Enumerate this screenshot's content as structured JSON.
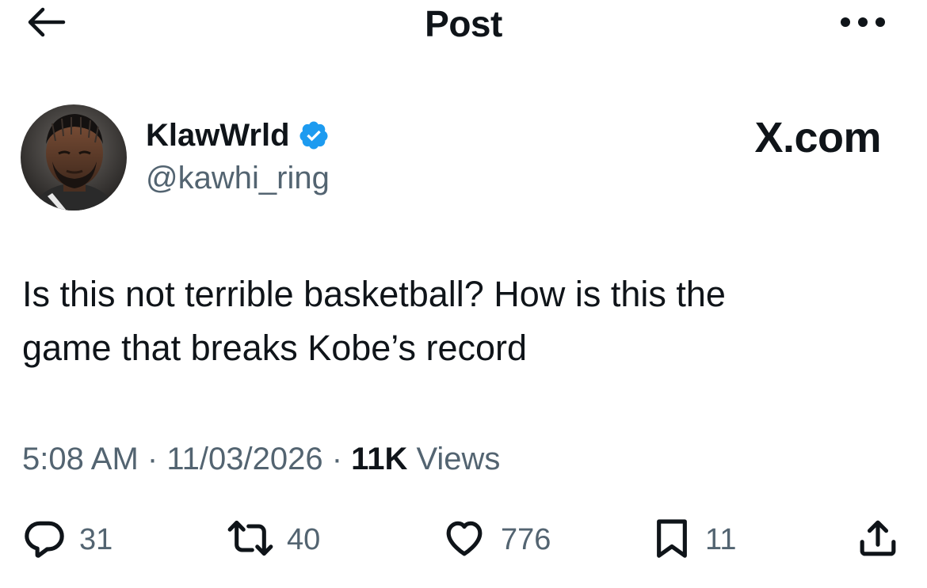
{
  "header": {
    "title": "Post"
  },
  "author": {
    "display_name": "KlawWrld",
    "handle": "@kawhi_ring",
    "verified": true
  },
  "source": "X.com",
  "post": {
    "text_line1": "Is this not terrible basketball? How is this the",
    "text_line2": "game that breaks Kobe’s record"
  },
  "meta": {
    "time": "5:08 AM",
    "separator": "·",
    "date": "11/03/2026",
    "views_count": "11K",
    "views_label": "Views"
  },
  "actions": {
    "replies": "31",
    "reposts": "40",
    "likes": "776",
    "bookmarks": "11"
  },
  "colors": {
    "text_primary": "#0f1419",
    "text_secondary": "#536471",
    "verified_blue": "#1d9bf0"
  },
  "icons": {
    "back": "arrow-left-icon",
    "more": "more-horizontal-icon",
    "verified": "verified-badge-icon",
    "reply": "reply-icon",
    "repost": "repost-icon",
    "like": "heart-icon",
    "bookmark": "bookmark-icon",
    "share": "share-icon"
  }
}
